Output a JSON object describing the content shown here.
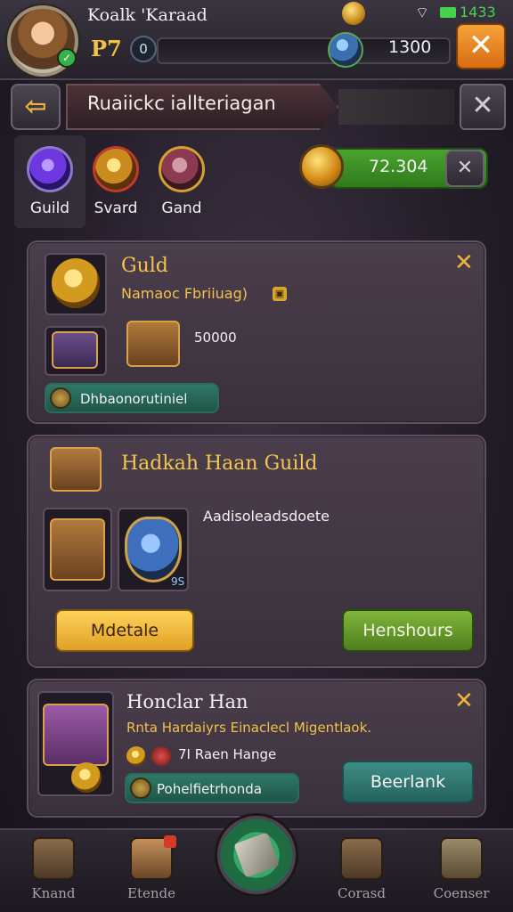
{
  "status_bar": {
    "time": "1433",
    "wifi_icon": "wifi-icon",
    "battery_icon": "battery-icon"
  },
  "player": {
    "name": "Koalk 'Karaad",
    "level_label": "P7",
    "level_number": "0",
    "xp_value": "1300"
  },
  "header": {
    "title": "Ruaiickc iallteriagan"
  },
  "categories": [
    {
      "label": "Guild",
      "icon": "purple-orb-icon"
    },
    {
      "label": "Svard",
      "icon": "gold-emblem-icon"
    },
    {
      "label": "Gand",
      "icon": "chest-icon"
    }
  ],
  "currency": {
    "value": "72.304",
    "icon": "gold-coin-icon"
  },
  "cards": [
    {
      "title": "Guld",
      "subtitle": "Namaoc Fbriiuag)",
      "amount": "50000",
      "button_label": "Dhbaonorutiniel"
    },
    {
      "title": "Hadkah Haan Guild",
      "description": "Aadisoleadsdoete",
      "slot_badge": "9S",
      "primary_button": "Mdetale",
      "secondary_button": "Henshours"
    },
    {
      "title": "Honclar Han",
      "subtitle": "Rnta Hardaiyrs Einaclecl Migentlaok.",
      "info": "7I Raen Hange",
      "pill_label": "Pohelfietrhonda",
      "button_label": "Beerlank"
    }
  ],
  "bottom_nav": [
    {
      "label": "Knand",
      "icon": "shield-icon"
    },
    {
      "label": "Etende",
      "icon": "horn-icon"
    },
    {
      "label": "",
      "icon": "center-scroll-icon"
    },
    {
      "label": "Corasd",
      "icon": "crate-icon"
    },
    {
      "label": "Coenser",
      "icon": "crossed-tools-icon"
    }
  ],
  "colors": {
    "accent_gold": "#f3c54a",
    "orange_button": "#e48a22",
    "green_button": "#5f9428",
    "teal_button": "#2f7868",
    "background": "#2e2632"
  }
}
